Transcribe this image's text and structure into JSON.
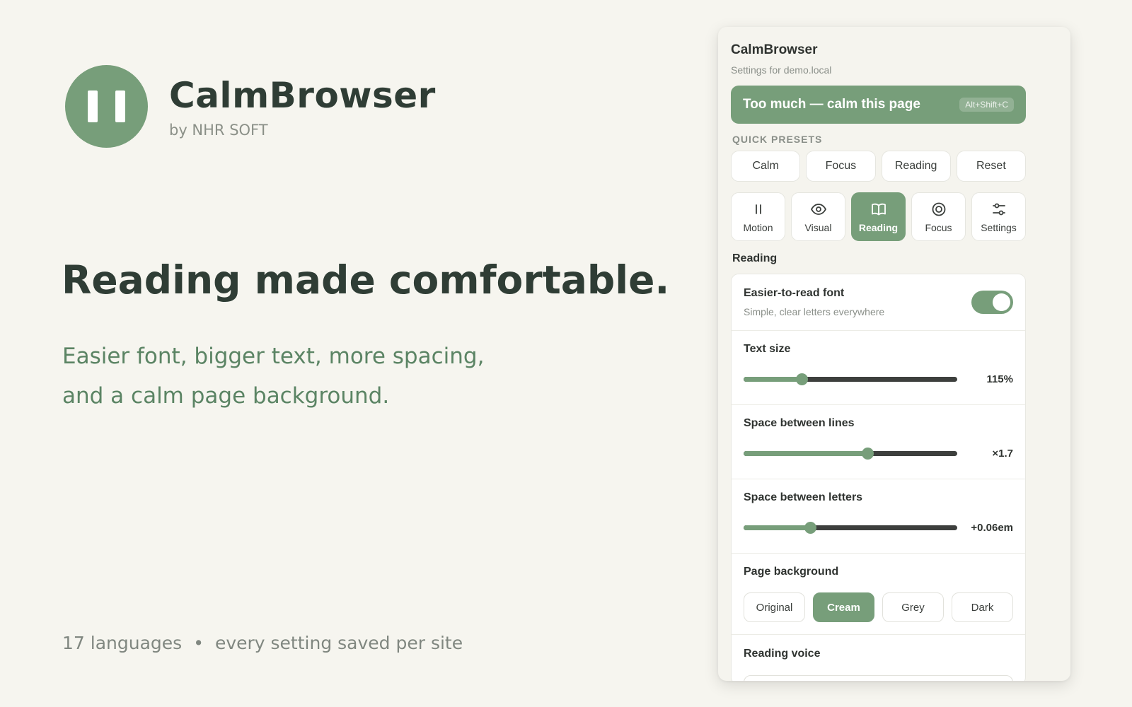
{
  "hero": {
    "brand_name": "CalmBrowser",
    "brand_by": "by NHR SOFT",
    "headline": "Reading made comfortable.",
    "subline_1": "Easier font, bigger text, more spacing,",
    "subline_2": "and a calm page background.",
    "footnote_left": "17 languages",
    "footnote_sep": "•",
    "footnote_right": "every setting saved per site"
  },
  "panel": {
    "title": "CalmBrowser",
    "subtitle": "Settings for demo.local",
    "calm_button": {
      "label": "Too much — calm this page",
      "shortcut": "Alt+Shift+C"
    },
    "quick_presets_label": "QUICK PRESETS",
    "presets": [
      "Calm",
      "Focus",
      "Reading",
      "Reset"
    ],
    "tabs": [
      {
        "label": "Motion",
        "icon": "pause-icon"
      },
      {
        "label": "Visual",
        "icon": "eye-icon"
      },
      {
        "label": "Reading",
        "icon": "book-icon",
        "active": true
      },
      {
        "label": "Focus",
        "icon": "target-icon"
      },
      {
        "label": "Settings",
        "icon": "sliders-icon"
      }
    ],
    "section_title": "Reading",
    "font_toggle": {
      "title": "Easier-to-read font",
      "description": "Simple, clear letters everywhere",
      "on": true
    },
    "text_size": {
      "title": "Text size",
      "value": "115%",
      "level": 0.27
    },
    "line_space": {
      "title": "Space between lines",
      "value": "×1.7",
      "level": 0.58
    },
    "letter_space": {
      "title": "Space between letters",
      "value": "+0.06em",
      "level": 0.31
    },
    "page_background": {
      "title": "Page background",
      "options": [
        "Original",
        "Cream",
        "Grey",
        "Dark"
      ],
      "selected": "Cream"
    },
    "reading_voice": {
      "title": "Reading voice"
    }
  },
  "colors": {
    "accent": "#779e7a",
    "background": "#f6f5ef",
    "text_dark": "#2f3d35",
    "subtitle_green": "#5b8464"
  }
}
